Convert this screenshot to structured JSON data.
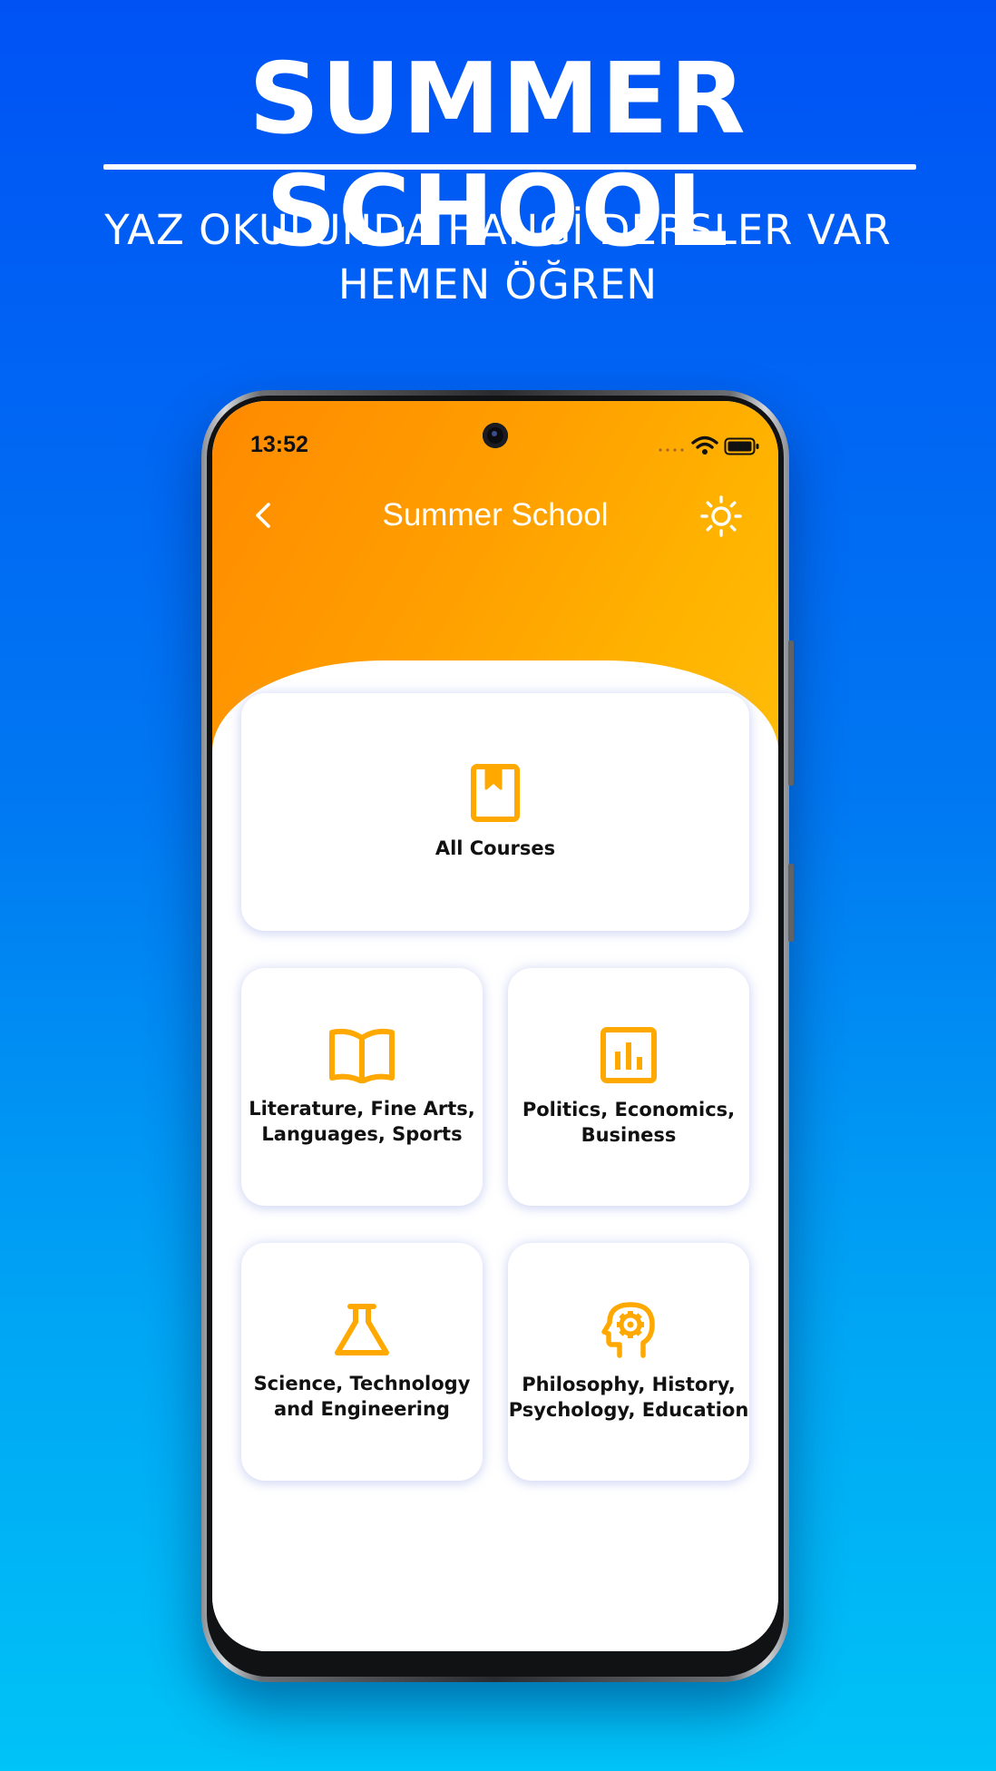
{
  "promo": {
    "title": "SUMMER SCHOOL",
    "subtitle_line1": "YAZ OKULUNDA HANGİ DERSLER VAR",
    "subtitle_line2": "HEMEN ÖĞREN"
  },
  "status_bar": {
    "time": "13:52",
    "icons": [
      "wifi-icon",
      "battery-icon"
    ]
  },
  "header": {
    "title": "Summer School",
    "back_icon": "chevron-left-icon",
    "theme_icon": "sun-icon"
  },
  "colors": {
    "accent": "#FFA800",
    "header_gradient_start": "#FF8A00",
    "header_gradient_end": "#FFBD09",
    "promo_background_top": "#0052F5",
    "promo_background_bottom": "#00C3F7"
  },
  "categories": [
    {
      "label": "All Courses",
      "icon": "book-bookmark-icon"
    },
    {
      "label": "Literature, Fine Arts,\nLanguages, Sports",
      "icon": "open-book-icon"
    },
    {
      "label": "Politics, Economics,\nBusiness",
      "icon": "bar-chart-icon"
    },
    {
      "label": "Science, Technology\nand Engineering",
      "icon": "flask-icon"
    },
    {
      "label": "Philosophy, History,\nPsychology, Education",
      "icon": "head-gear-icon"
    }
  ]
}
